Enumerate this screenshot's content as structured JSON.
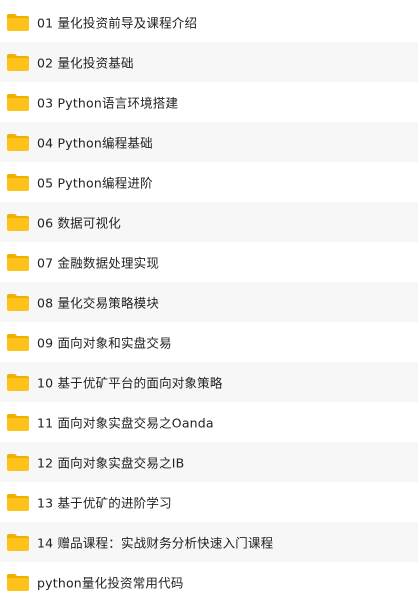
{
  "folder_icon_color": "#FFC21A",
  "folder_icon_tab_color": "#F0B000",
  "folders": [
    {
      "label": "01 量化投资前导及课程介绍",
      "icon": "folder-icon"
    },
    {
      "label": "02 量化投资基础",
      "icon": "folder-icon"
    },
    {
      "label": "03 Python语言环境搭建",
      "icon": "folder-icon"
    },
    {
      "label": "04 Python编程基础",
      "icon": "folder-icon"
    },
    {
      "label": "05 Python编程进阶",
      "icon": "folder-icon"
    },
    {
      "label": "06 数据可视化",
      "icon": "folder-icon"
    },
    {
      "label": "07 金融数据处理实现",
      "icon": "folder-icon"
    },
    {
      "label": "08 量化交易策略模块",
      "icon": "folder-icon"
    },
    {
      "label": "09 面向对象和实盘交易",
      "icon": "folder-icon"
    },
    {
      "label": "10 基于优矿平台的面向对象策略",
      "icon": "folder-icon"
    },
    {
      "label": "11 面向对象实盘交易之Oanda",
      "icon": "folder-icon"
    },
    {
      "label": "12 面向对象实盘交易之IB",
      "icon": "folder-icon"
    },
    {
      "label": "13 基于优矿的进阶学习",
      "icon": "folder-icon"
    },
    {
      "label": "14 赠品课程：实战财务分析快速入门课程",
      "icon": "folder-icon"
    },
    {
      "label": "python量化投资常用代码",
      "icon": "folder-icon"
    }
  ]
}
